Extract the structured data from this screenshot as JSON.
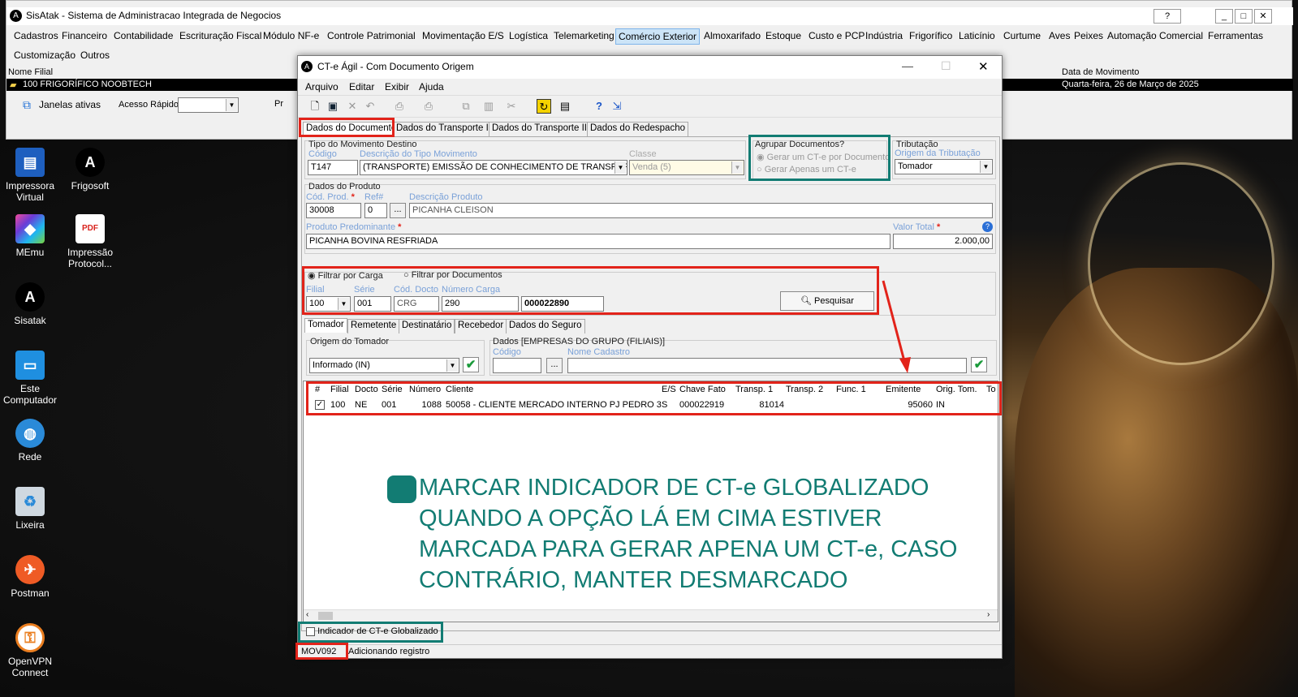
{
  "main": {
    "title": "SisAtak - Sistema de Administracao Integrada de Negocios",
    "help_btn": "?",
    "menu_row1": [
      "Cadastros",
      "Financeiro",
      "Contabilidade",
      "Escrituração Fiscal",
      "Módulo NF-e",
      "Controle Patrimonial",
      "Movimentação E/S",
      "Logística",
      "Telemarketing",
      "Comércio Exterior",
      "Almoxarifado",
      "Estoque",
      "Custo e PCP",
      "Indústria",
      "Frigorífico",
      "Laticínio",
      "Curtume",
      "Aves",
      "Peixes",
      "Automação Comercial",
      "Ferramentas"
    ],
    "menu_row2": [
      "Customização",
      "Outros"
    ],
    "nome_filial_label": "Nome Filial",
    "filial_value": "100 FRIGORÍFICO NOOBTECH",
    "data_mov_label": "Data de Movimento",
    "data_mov_value": "Quarta-feira, 26 de Março de 2025",
    "janelas_ativas": "Janelas ativas",
    "acesso_rapido": "Acesso Rápido",
    "pr_label": "Pr"
  },
  "desktop_icons": [
    {
      "label": "Impressora Virtual"
    },
    {
      "label": "Frigosoft"
    },
    {
      "label": "MEmu"
    },
    {
      "label": "Impressão Protocol..."
    },
    {
      "label": "Sisatak"
    },
    {
      "label": "Este Computador"
    },
    {
      "label": "Rede"
    },
    {
      "label": "Lixeira"
    },
    {
      "label": "Postman"
    },
    {
      "label": "OpenVPN Connect"
    }
  ],
  "pdf_badge": "PDF",
  "cte": {
    "title": "CT-e Ágil - Com Documento Origem",
    "menu": [
      "Arquivo",
      "Editar",
      "Exibir",
      "Ajuda"
    ],
    "tabs": [
      "Dados do Documento",
      "Dados do Transporte I",
      "Dados do Transporte II",
      "Dados do Redespacho"
    ],
    "tipo_mov_title": "Tipo do Movimento Destino",
    "codigo_label": "Código",
    "codigo_value": "T147",
    "desc_tipo_label": "Descrição do Tipo Movimento",
    "desc_tipo_value": "(TRANSPORTE) EMISSÃO DE CONHECIMENTO DE TRANSPORTE -",
    "classe_label": "Classe",
    "classe_value": "Venda (5)",
    "agrupar_title": "Agrupar Documentos?",
    "agrupar_opt1": "Gerar um CT-e por Documento",
    "agrupar_opt2": "Gerar Apenas um CT-e",
    "tributacao_title": "Tributação",
    "origem_trib_label": "Origem da Tributação",
    "origem_trib_value": "Tomador",
    "produto_title": "Dados do Produto",
    "cod_prod_label": "Cód. Prod.",
    "cod_prod_value": "30008",
    "ref_label": "Ref#",
    "ref_value": "0",
    "desc_prod_label": "Descrição Produto",
    "desc_prod_value": "PICANHA CLEISON",
    "prod_pred_label": "Produto Predominante",
    "prod_pred_value": "PICANHA BOVINA RESFRIADA",
    "valor_total_label": "Valor Total",
    "valor_total_value": "2.000,00",
    "filtrar_carga": "Filtrar por Carga",
    "filtrar_docs": "Filtrar por Documentos",
    "filial_label": "Filial",
    "filial_value": "100",
    "serie_label": "Série",
    "serie_value": "001",
    "cod_docto_label": "Cód. Docto",
    "cod_docto_value": "CRG",
    "num_carga_label": "Número Carga",
    "num_carga_value": "290",
    "carga_code": "000022890",
    "pesquisar": "Pesquisar",
    "subtabs": [
      "Tomador",
      "Remetente",
      "Destinatário",
      "Recebedor",
      "Dados do Seguro"
    ],
    "origem_tomador_title": "Origem do Tomador",
    "origem_tomador_value": "Informado (IN)",
    "empresas_title": "Dados [EMPRESAS DO GRUPO (FILIAIS)]",
    "emp_codigo_label": "Código",
    "emp_nome_label": "Nome Cadastro",
    "ellipsis": "...",
    "grid_headers": [
      "#",
      "Filial",
      "Docto",
      "Série",
      "Número",
      "Cliente",
      "E/S",
      "Chave Fato",
      "Transp. 1",
      "Transp. 2",
      "Func. 1",
      "Emitente",
      "Orig. Tom.",
      "To"
    ],
    "grid_row": {
      "filial": "100",
      "docto": "NE",
      "serie": "001",
      "numero": "1088",
      "cliente": "50058 - CLIENTE MERCADO INTERNO PJ PEDRO 3",
      "es": "S",
      "chave": "000022919",
      "transp1": "81014",
      "transp2": "",
      "func1": "",
      "emitente": "95060",
      "origtom": "IN"
    },
    "note": "MARCAR INDICADOR DE CT-e GLOBALIZADO QUANDO A OPÇÃO LÁ EM CIMA ESTIVER MARCADA PARA GERAR APENA UM CT-e, CASO CONTRÁRIO, MANTER DESMARCADO",
    "indicador_global": "Indicador de CT-e Globalizado",
    "status_code": "MOV092",
    "status_text": "Adicionando registro"
  },
  "colors": {
    "red_highlight": "#e2231a",
    "teal_highlight": "#127c73"
  }
}
